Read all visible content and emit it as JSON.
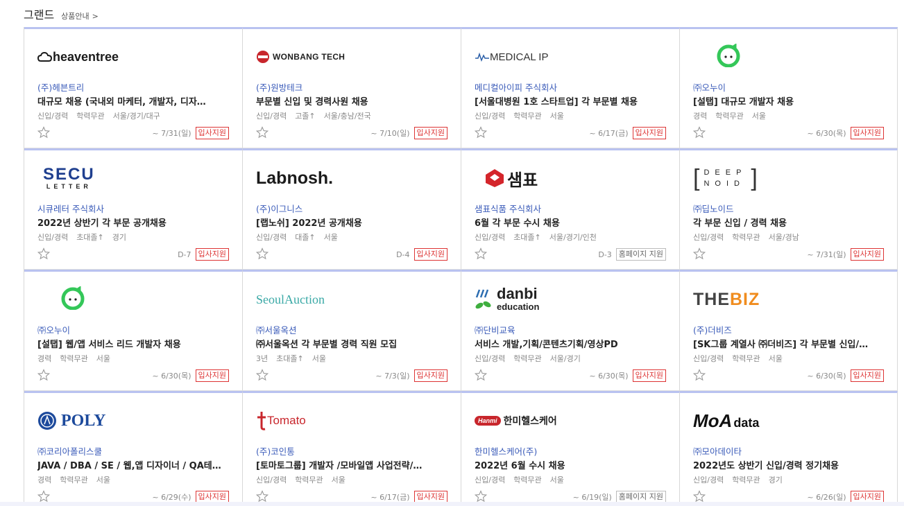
{
  "header": {
    "title": "그랜드",
    "subtitle": "상품안내",
    "chevron": ">"
  },
  "colors": {
    "accent_top_border": "#b9c2f0",
    "company_text": "#3a5bb9",
    "apply_red": "#d33333"
  },
  "cards": [
    {
      "logo": "heaventree",
      "logo_text": "heaventree",
      "company": "(주)헤븐트리",
      "title": "대규모 채용 (국내외 마케터, 개발자, 디자…",
      "meta": [
        "신입/경력",
        "학력무관",
        "서울/경기/대구"
      ],
      "deadline": "~ 7/31(일)",
      "button": "입사지원",
      "button_type": "apply"
    },
    {
      "logo": "wonbang",
      "logo_text": "WONBANG TECH",
      "company": "(주)원방테크",
      "title": "부문별 신입 및 경력사원 채용",
      "meta": [
        "신입/경력",
        "고졸↑",
        "서울/충남/전국"
      ],
      "deadline": "~ 7/10(일)",
      "button": "입사지원",
      "button_type": "apply"
    },
    {
      "logo": "medical",
      "logo_text": "MEDICAL IP",
      "company": "메디컬아이피 주식회사",
      "title": "[서울대병원 1호 스타트업] 각 부문별 채용",
      "meta": [
        "신입/경력",
        "학력무관",
        "서울"
      ],
      "deadline": "~ 6/17(금)",
      "button": "입사지원",
      "button_type": "apply"
    },
    {
      "logo": "ohnui",
      "logo_text": "",
      "company": "㈜오누이",
      "title": "[설탭] 대규모 개발자 채용",
      "meta": [
        "경력",
        "학력무관",
        "서울"
      ],
      "deadline": "~ 6/30(목)",
      "button": "입사지원",
      "button_type": "apply"
    },
    {
      "logo": "secu",
      "logo_text": "SECU",
      "logo_text2": "LETTER",
      "company": "시큐레터 주식회사",
      "title": "2022년 상반기 각 부문 공개채용",
      "meta": [
        "신입/경력",
        "초대졸↑",
        "경기"
      ],
      "deadline": "D-7",
      "button": "입사지원",
      "button_type": "apply"
    },
    {
      "logo": "labnosh",
      "logo_text": "Labnosh.",
      "company": "(주)이그니스",
      "title": "[랩노쉬] 2022년 공개채용",
      "meta": [
        "신입/경력",
        "대졸↑",
        "서울"
      ],
      "deadline": "D-4",
      "button": "입사지원",
      "button_type": "apply"
    },
    {
      "logo": "sampyo",
      "logo_text": "샘표",
      "company": "샘표식품 주식회사",
      "title": "6월 각 부문 수시 채용",
      "meta": [
        "신입/경력",
        "초대졸↑",
        "서울/경기/인천"
      ],
      "deadline": "D-3",
      "button": "홈페이지 지원",
      "button_type": "home"
    },
    {
      "logo": "deepnoid",
      "logo_text": "DEEP",
      "logo_text2": "NOID",
      "company": "㈜딥노이드",
      "title": "각 부문 신입 / 경력 채용",
      "meta": [
        "신입/경력",
        "학력무관",
        "서울/경남"
      ],
      "deadline": "~ 7/31(일)",
      "button": "입사지원",
      "button_type": "apply"
    },
    {
      "logo": "ohnui",
      "logo_text": "",
      "company": "㈜오누이",
      "title": "[설탭] 웹/앱 서비스 리드 개발자 채용",
      "meta": [
        "경력",
        "학력무관",
        "서울"
      ],
      "deadline": "~ 6/30(목)",
      "button": "입사지원",
      "button_type": "apply"
    },
    {
      "logo": "seoulauction",
      "logo_text": "SeoulAuction",
      "company": "㈜서울옥션",
      "title": "㈜서울옥션 각 부문별 경력 직원 모집",
      "meta": [
        "3년",
        "초대졸↑",
        "서울"
      ],
      "deadline": "~ 7/3(일)",
      "button": "입사지원",
      "button_type": "apply"
    },
    {
      "logo": "danbi",
      "logo_text": "danbi",
      "logo_text2": "education",
      "company": "㈜단비교육",
      "title": "서비스 개발,기획/콘텐츠기획/영상PD",
      "meta": [
        "신입/경력",
        "학력무관",
        "서울/경기"
      ],
      "deadline": "~ 6/30(목)",
      "button": "입사지원",
      "button_type": "apply"
    },
    {
      "logo": "thebiz",
      "logo_text": "THE",
      "logo_text2": "BIZ",
      "company": "(주)더비즈",
      "title": "[SK그룹 계열사 ㈜더비즈] 각 부문별 신입/…",
      "meta": [
        "신입/경력",
        "학력무관",
        "서울"
      ],
      "deadline": "~ 6/30(목)",
      "button": "입사지원",
      "button_type": "apply"
    },
    {
      "logo": "poly",
      "logo_text": "POLY",
      "company": "㈜코리아폴리스쿨",
      "title": "JAVA / DBA / SE / 웹,앱 디자이너 / QA테…",
      "meta": [
        "경력",
        "학력무관",
        "서울"
      ],
      "deadline": "~ 6/29(수)",
      "button": "입사지원",
      "button_type": "apply"
    },
    {
      "logo": "tomato",
      "logo_text": "Tomato",
      "company": "(주)코인통",
      "title": "[토마토그룹] 개발자 /모바일앱 사업전략/…",
      "meta": [
        "신입/경력",
        "학력무관",
        "서울"
      ],
      "deadline": "~ 6/17(금)",
      "button": "입사지원",
      "button_type": "apply"
    },
    {
      "logo": "hanmi",
      "logo_text": "Hanmi",
      "logo_text2": "한미헬스케어",
      "company": "한미헬스케어(주)",
      "title": "2022년 6월 수시 채용",
      "meta": [
        "신입/경력",
        "학력무관",
        "서울"
      ],
      "deadline": "~ 6/19(일)",
      "button": "홈페이지 지원",
      "button_type": "home"
    },
    {
      "logo": "moadata",
      "logo_text": "MoA",
      "logo_text2": "data",
      "company": "㈜모아데이타",
      "title": "2022년도 상반기 신입/경력 정기채용",
      "meta": [
        "신입/경력",
        "학력무관",
        "경기"
      ],
      "deadline": "~ 6/26(일)",
      "button": "입사지원",
      "button_type": "apply"
    }
  ]
}
